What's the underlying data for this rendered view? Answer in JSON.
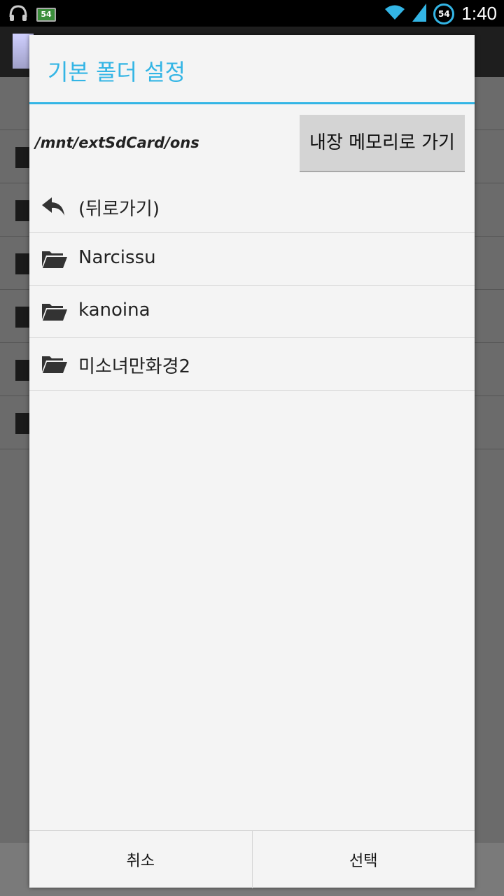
{
  "status_bar": {
    "time": "1:40",
    "battery_level": "54",
    "battery_circle_level": "54",
    "icons": [
      "headphones-icon",
      "battery-icon",
      "wifi-icon",
      "signal-icon"
    ]
  },
  "dialog": {
    "title": "기본 폴더 설정",
    "current_path": "/mnt/extSdCard/ons",
    "internal_memory_button": "내장 메모리로 가기",
    "items": [
      {
        "label": "(뒤로가기)",
        "icon": "back-arrow-icon"
      },
      {
        "label": "Narcissu",
        "icon": "folder-icon"
      },
      {
        "label": "kanoina",
        "icon": "folder-icon"
      },
      {
        "label": "미소녀만화경2",
        "icon": "folder-icon"
      }
    ],
    "cancel_label": "취소",
    "select_label": "선택"
  },
  "colors": {
    "accent": "#33b5e5",
    "dialog_background": "#f4f4f4"
  }
}
